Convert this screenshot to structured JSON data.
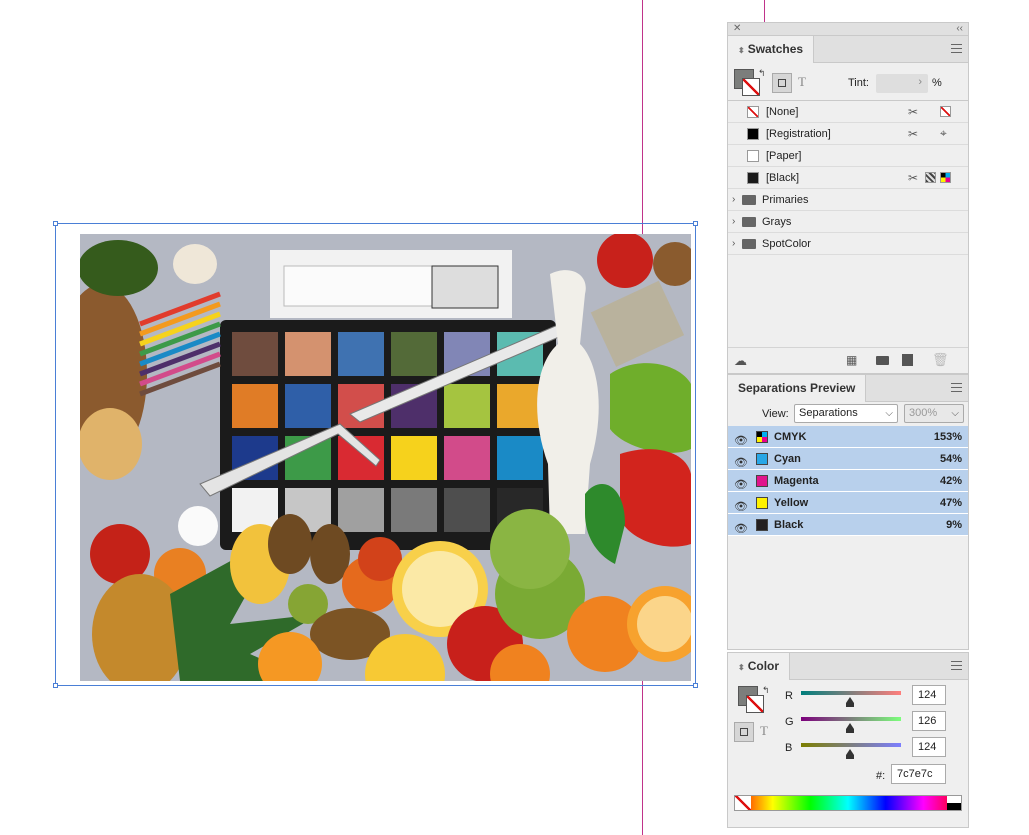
{
  "colors": {
    "guide_magenta": "#c0338a",
    "selection_blue": "#4a7fd6",
    "highlight_row": "#b8d0ec"
  },
  "swatches_panel": {
    "title": "Swatches",
    "tint_label": "Tint:",
    "tint_value": "",
    "tint_unit": "%",
    "text_toggle": "T",
    "swatches": [
      {
        "name": "[None]",
        "color": "none"
      },
      {
        "name": "[Registration]",
        "color": "#000000"
      },
      {
        "name": "[Paper]",
        "color": "#ffffff"
      },
      {
        "name": "[Black]",
        "color": "#1a1a1a"
      }
    ],
    "groups": [
      "Primaries",
      "Grays",
      "SpotColor"
    ]
  },
  "separations_panel": {
    "title": "Separations Preview",
    "view_label": "View:",
    "view_value": "Separations",
    "zoom_value": "300%",
    "inks": [
      {
        "name": "CMYK",
        "percent": "153%",
        "color": "cmyk"
      },
      {
        "name": "Cyan",
        "percent": "54%",
        "color": "#29a7e6"
      },
      {
        "name": "Magenta",
        "percent": "42%",
        "color": "#e0148c"
      },
      {
        "name": "Yellow",
        "percent": "47%",
        "color": "#fff200"
      },
      {
        "name": "Black",
        "percent": "9%",
        "color": "#231f20"
      }
    ]
  },
  "color_panel": {
    "title": "Color",
    "channels": [
      {
        "label": "R",
        "value": "124",
        "level": 0.486
      },
      {
        "label": "G",
        "value": "126",
        "level": 0.494
      },
      {
        "label": "B",
        "value": "124",
        "level": 0.486
      }
    ],
    "hex_label": "#:",
    "hex_value": "7c7e7c",
    "text_toggle": "T"
  }
}
